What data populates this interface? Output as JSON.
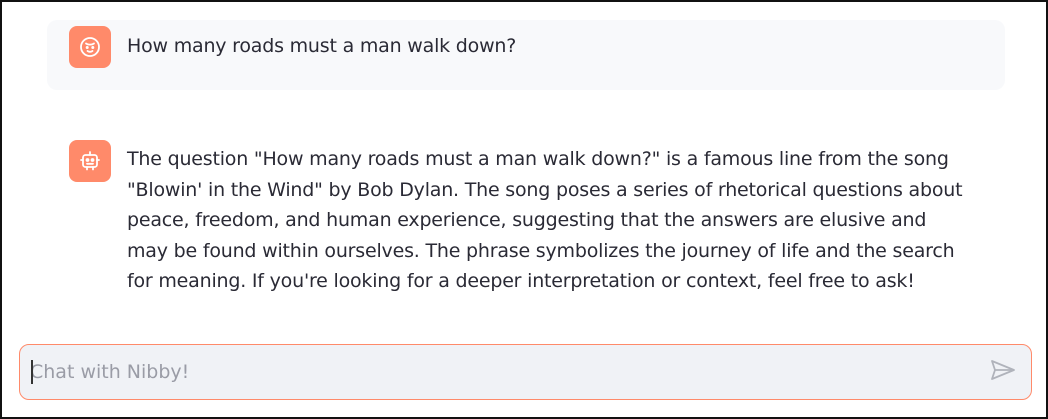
{
  "messages": [
    {
      "role": "user",
      "avatar_icon": "face-icon",
      "text": "How many roads must a man walk down?"
    },
    {
      "role": "assistant",
      "avatar_icon": "robot-icon",
      "text": "The question \"How many roads must a man walk down?\" is a famous line from the song \"Blowin' in the Wind\" by Bob Dylan. The song poses a series of rhetorical questions about peace, freedom, and human experience, suggesting that the answers are elusive and may be found within ourselves. The phrase symbolizes the journey of life and the search for meaning. If you're looking for a deeper interpretation or context, feel free to ask!"
    }
  ],
  "chat_input": {
    "placeholder": "Chat with Nibby!",
    "value": ""
  },
  "send_icon": "send-icon",
  "colors": {
    "accent": "#ff8a6a",
    "user_bubble_bg": "#f8f9fb",
    "input_bg": "#f0f2f6",
    "text": "#2a2a35",
    "placeholder": "#9a9ca6"
  }
}
